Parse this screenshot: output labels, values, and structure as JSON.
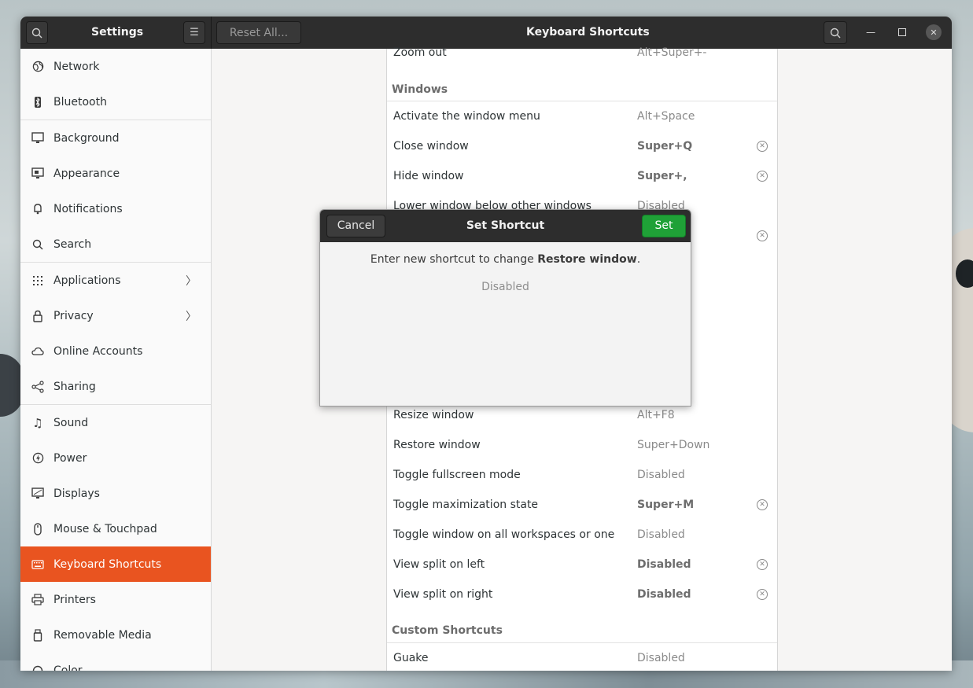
{
  "window": {
    "sidebar_title": "Settings",
    "main_title": "Keyboard Shortcuts",
    "reset_label": "Reset All..."
  },
  "sidebar": {
    "items": [
      {
        "label": "Network",
        "icon": "globe-icon"
      },
      {
        "label": "Bluetooth",
        "icon": "bluetooth-icon"
      },
      {
        "label": "Background",
        "icon": "monitor-icon"
      },
      {
        "label": "Appearance",
        "icon": "appearance-icon"
      },
      {
        "label": "Notifications",
        "icon": "bell-icon"
      },
      {
        "label": "Search",
        "icon": "search-icon"
      },
      {
        "label": "Applications",
        "icon": "grid-icon"
      },
      {
        "label": "Privacy",
        "icon": "lock-icon"
      },
      {
        "label": "Online Accounts",
        "icon": "cloud-icon"
      },
      {
        "label": "Sharing",
        "icon": "share-icon"
      },
      {
        "label": "Sound",
        "icon": "music-note-icon"
      },
      {
        "label": "Power",
        "icon": "power-icon"
      },
      {
        "label": "Displays",
        "icon": "display-icon"
      },
      {
        "label": "Mouse & Touchpad",
        "icon": "mouse-icon"
      },
      {
        "label": "Keyboard Shortcuts",
        "icon": "keyboard-icon",
        "active": true
      },
      {
        "label": "Printers",
        "icon": "printer-icon"
      },
      {
        "label": "Removable Media",
        "icon": "usb-icon"
      },
      {
        "label": "Color",
        "icon": "color-icon"
      }
    ]
  },
  "shortcuts": {
    "top_row": {
      "name": "Zoom out",
      "accel": "Alt+Super+-"
    },
    "windows_section": "Windows",
    "windows_rows": [
      {
        "name": "Activate the window menu",
        "accel": "Alt+Space"
      },
      {
        "name": "Close window",
        "accel": "Super+Q"
      },
      {
        "name": "Hide window",
        "accel": "Super+,"
      },
      {
        "name": "Lower window below other windows",
        "accel": "Disabled"
      }
    ],
    "lower_rows": [
      {
        "name": "Resize window",
        "accel": "Alt+F8"
      },
      {
        "name": "Restore window",
        "accel": "Super+Down"
      },
      {
        "name": "Toggle fullscreen mode",
        "accel": "Disabled"
      },
      {
        "name": "Toggle maximization state",
        "accel": "Super+M"
      },
      {
        "name": "Toggle window on all workspaces or one",
        "accel": "Disabled"
      },
      {
        "name": "View split on left",
        "accel": "Disabled"
      },
      {
        "name": "View split on right",
        "accel": "Disabled"
      }
    ],
    "custom_section": "Custom Shortcuts",
    "custom_rows": [
      {
        "name": "Guake",
        "accel": "Disabled"
      }
    ]
  },
  "dialog": {
    "title": "Set Shortcut",
    "cancel_label": "Cancel",
    "set_label": "Set",
    "message_prefix": "Enter new shortcut to change ",
    "message_target": "Restore window",
    "message_suffix": ".",
    "current_value": "Disabled"
  },
  "colors": {
    "accent": "#e95420",
    "set_button": "#1fa137"
  }
}
